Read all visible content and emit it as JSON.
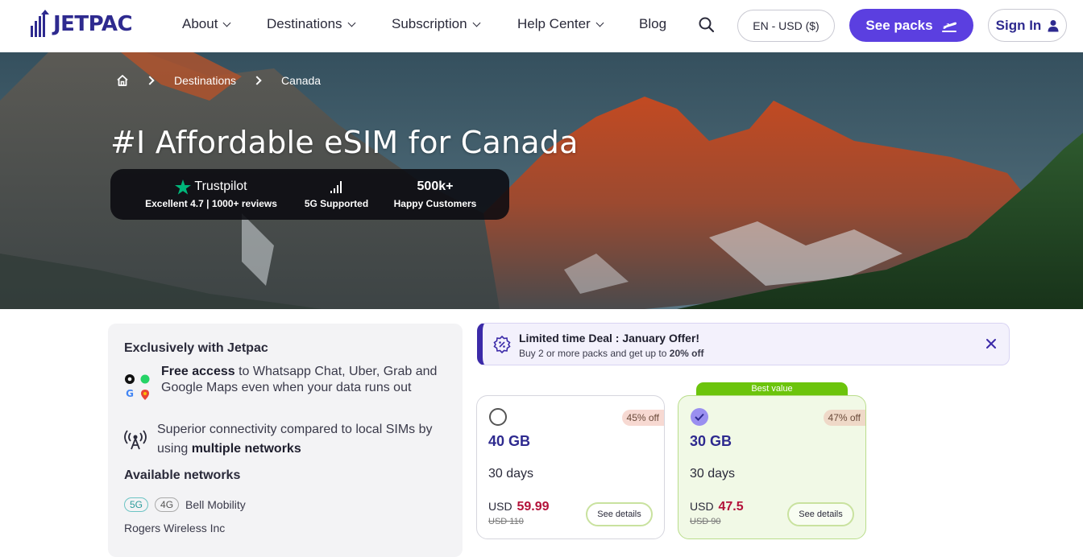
{
  "header": {
    "logo_text": "JETPAC",
    "nav": [
      {
        "label": "About"
      },
      {
        "label": "Destinations"
      },
      {
        "label": "Subscription"
      },
      {
        "label": "Help Center"
      },
      {
        "label": "Blog"
      }
    ],
    "language_currency": "EN - USD ($)",
    "see_packs_label": "See packs",
    "sign_in_label": "Sign In"
  },
  "hero": {
    "breadcrumb": {
      "home_icon": "home-icon",
      "items": [
        "Destinations",
        "Canada"
      ]
    },
    "title": "#I Affordable eSIM for Canada",
    "stats": {
      "trustpilot_label": "Trustpilot",
      "trustpilot_sub": "Excellent 4.7 | 1000+ reviews",
      "network_sub": "5G Supported",
      "customers_value": "500k+",
      "customers_sub": "Happy Customers"
    }
  },
  "features": {
    "exclusive_heading": "Exclusively with Jetpac",
    "free_access_bold": "Free access",
    "free_access_text": " to Whatsapp Chat, Uber, Grab and Google Maps even when your data runs out",
    "connectivity_text": "Superior connectivity compared to local SIMs by using ",
    "connectivity_bold": "multiple networks",
    "networks_heading": "Available networks",
    "networks": [
      {
        "tags": [
          "5G",
          "4G"
        ],
        "name": "Bell Mobility"
      },
      {
        "tags": [],
        "name": "Rogers Wireless Inc"
      }
    ]
  },
  "deal": {
    "title": "Limited time Deal : January Offer!",
    "subtitle_prefix": "Buy 2 or more packs and get up to ",
    "subtitle_bold": "20% off"
  },
  "plans": [
    {
      "data": "40 GB",
      "duration": "30 days",
      "currency": "USD",
      "price": "59.99",
      "old_price": "USD 110",
      "discount": "45% off",
      "selected": false,
      "details_label": "See details"
    },
    {
      "data": "30 GB",
      "duration": "30 days",
      "currency": "USD",
      "price": "47.5",
      "old_price": "USD 90",
      "discount": "47% off",
      "selected": true,
      "best_value": "Best value",
      "details_label": "See details"
    }
  ],
  "colors": {
    "brand": "#2e2a8f",
    "primary_button": "#5b3fe0",
    "price": "#b3123a",
    "best_value_tag": "#6cc40c"
  }
}
